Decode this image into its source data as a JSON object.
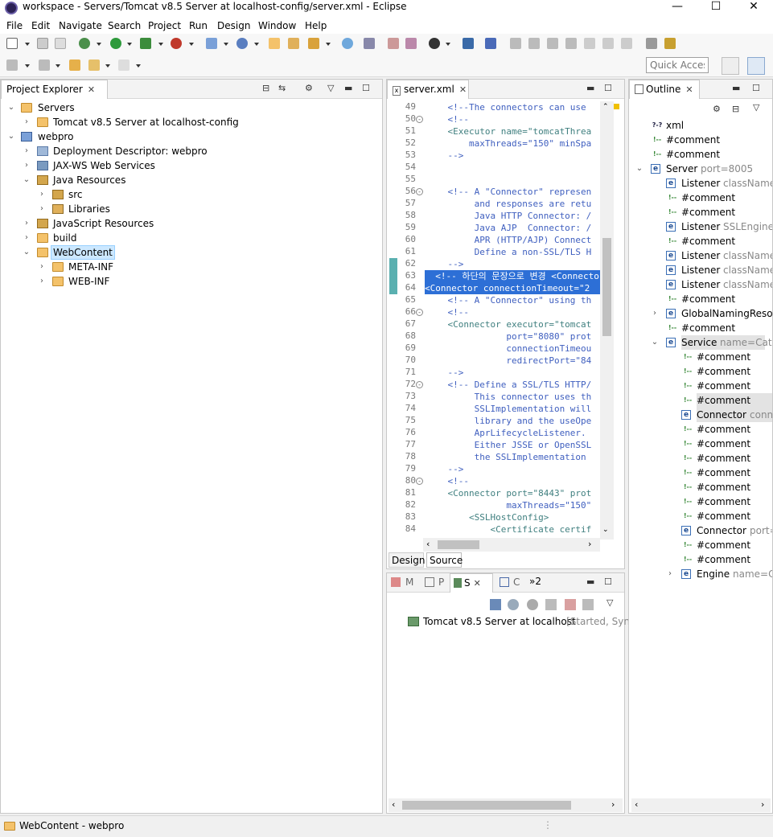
{
  "window": {
    "title": "workspace - Servers/Tomcat v8.5 Server at localhost-config/server.xml - Eclipse",
    "controls": {
      "minimize": "—",
      "maximize": "☐",
      "close": "✕"
    }
  },
  "menu": [
    "File",
    "Edit",
    "Navigate",
    "Search",
    "Project",
    "Run",
    "Design",
    "Window",
    "Help"
  ],
  "quick_access": {
    "placeholder": "Quick Access"
  },
  "project_explorer": {
    "tab_label": "Project Explorer",
    "close": "✕",
    "items": [
      {
        "label": "Servers",
        "icon": "folder-icon",
        "expanded": true
      },
      {
        "label": "Tomcat v8.5 Server at localhost-config",
        "icon": "folder-icon",
        "expanded": false
      },
      {
        "label": "webpro",
        "icon": "project-icon",
        "expanded": true
      },
      {
        "label": "Deployment Descriptor: webpro",
        "icon": "descriptor-icon",
        "expanded": false
      },
      {
        "label": "JAX-WS Web Services",
        "icon": "webservice-icon",
        "expanded": false
      },
      {
        "label": "Java Resources",
        "icon": "java-resources-icon",
        "expanded": true
      },
      {
        "label": "src",
        "icon": "package-folder-icon",
        "expanded": false
      },
      {
        "label": "Libraries",
        "icon": "library-icon",
        "expanded": false
      },
      {
        "label": "JavaScript Resources",
        "icon": "js-resources-icon",
        "expanded": false
      },
      {
        "label": "build",
        "icon": "folder-icon",
        "expanded": false
      },
      {
        "label": "WebContent",
        "icon": "folder-icon",
        "expanded": true,
        "selected": true
      },
      {
        "label": "META-INF",
        "icon": "folder-icon",
        "expanded": false
      },
      {
        "label": "WEB-INF",
        "icon": "folder-icon",
        "expanded": false
      }
    ]
  },
  "editor": {
    "tab_label": "server.xml",
    "close": "✕",
    "bottom_tabs": [
      "Design",
      "Source"
    ],
    "active_bottom_tab": "Source",
    "lines": [
      {
        "n": "49",
        "text": "    <!--The connectors can use"
      },
      {
        "n": "50",
        "text": "    <!--",
        "fold": true
      },
      {
        "n": "51",
        "text": "    <Executor name=\"tomcatThrea"
      },
      {
        "n": "52",
        "text": "        maxThreads=\"150\" minSpa"
      },
      {
        "n": "53",
        "text": "    -->"
      },
      {
        "n": "54",
        "text": ""
      },
      {
        "n": "55",
        "text": ""
      },
      {
        "n": "56",
        "text": "    <!-- A \"Connector\" represen",
        "fold": true
      },
      {
        "n": "57",
        "text": "         and responses are retu"
      },
      {
        "n": "58",
        "text": "         Java HTTP Connector: /"
      },
      {
        "n": "59",
        "text": "         Java AJP  Connector: /"
      },
      {
        "n": "60",
        "text": "         APR (HTTP/AJP) Connect"
      },
      {
        "n": "61",
        "text": "         Define a non-SSL/TLS H"
      },
      {
        "n": "62",
        "text": "    -->"
      },
      {
        "n": "63",
        "text": "  <!-- 하단의 문장으로 변경 <Connector",
        "highlight": true
      },
      {
        "n": "64",
        "text": "<Connector connectionTimeout=\"2",
        "highlight": true
      },
      {
        "n": "65",
        "text": "    <!-- A \"Connector\" using th"
      },
      {
        "n": "66",
        "text": "    <!--",
        "fold": true
      },
      {
        "n": "67",
        "text": "    <Connector executor=\"tomcat"
      },
      {
        "n": "68",
        "text": "               port=\"8080\" prot"
      },
      {
        "n": "69",
        "text": "               connectionTimeou"
      },
      {
        "n": "70",
        "text": "               redirectPort=\"84"
      },
      {
        "n": "71",
        "text": "    -->"
      },
      {
        "n": "72",
        "text": "    <!-- Define a SSL/TLS HTTP/",
        "fold": true
      },
      {
        "n": "73",
        "text": "         This connector uses th"
      },
      {
        "n": "74",
        "text": "         SSLImplementation will"
      },
      {
        "n": "75",
        "text": "         library and the useOpe"
      },
      {
        "n": "76",
        "text": "         AprLifecycleListener."
      },
      {
        "n": "77",
        "text": "         Either JSSE or OpenSSL"
      },
      {
        "n": "78",
        "text": "         the SSLImplementation"
      },
      {
        "n": "79",
        "text": "    -->"
      },
      {
        "n": "80",
        "text": "    <!--",
        "fold": true
      },
      {
        "n": "81",
        "text": "    <Connector port=\"8443\" prot"
      },
      {
        "n": "82",
        "text": "               maxThreads=\"150\""
      },
      {
        "n": "83",
        "text": "        <SSLHostConfig>"
      },
      {
        "n": "84",
        "text": "            <Certificate certif"
      }
    ]
  },
  "outline": {
    "tab_label": "Outline",
    "close": "✕",
    "items": [
      {
        "kind": "pi",
        "label": "xml",
        "extra": ""
      },
      {
        "kind": "comment",
        "label": "#comment",
        "extra": ""
      },
      {
        "kind": "comment",
        "label": "#comment",
        "extra": ""
      },
      {
        "kind": "element",
        "label": "Server",
        "extra": "port=8005",
        "expanded": true
      },
      {
        "kind": "element",
        "label": "Listener",
        "extra": "className="
      },
      {
        "kind": "comment",
        "label": "#comment",
        "extra": ""
      },
      {
        "kind": "comment",
        "label": "#comment",
        "extra": ""
      },
      {
        "kind": "element",
        "label": "Listener",
        "extra": "SSLEngine="
      },
      {
        "kind": "comment",
        "label": "#comment",
        "extra": ""
      },
      {
        "kind": "element",
        "label": "Listener",
        "extra": "className="
      },
      {
        "kind": "element",
        "label": "Listener",
        "extra": "className="
      },
      {
        "kind": "element",
        "label": "Listener",
        "extra": "className="
      },
      {
        "kind": "comment",
        "label": "#comment",
        "extra": ""
      },
      {
        "kind": "element",
        "label": "GlobalNamingResou",
        "extra": "",
        "collapsed": true
      },
      {
        "kind": "comment",
        "label": "#comment",
        "extra": ""
      },
      {
        "kind": "element",
        "label": "Service",
        "extra": "name=Catali",
        "expanded": true,
        "hl": true
      },
      {
        "kind": "comment",
        "label": "#comment",
        "extra": ""
      },
      {
        "kind": "comment",
        "label": "#comment",
        "extra": ""
      },
      {
        "kind": "comment",
        "label": "#comment",
        "extra": ""
      },
      {
        "kind": "comment",
        "label": "#comment",
        "extra": "",
        "hl": true
      },
      {
        "kind": "element",
        "label": "Connector",
        "extra": "conne",
        "hl": true
      },
      {
        "kind": "comment",
        "label": "#comment",
        "extra": ""
      },
      {
        "kind": "comment",
        "label": "#comment",
        "extra": ""
      },
      {
        "kind": "comment",
        "label": "#comment",
        "extra": ""
      },
      {
        "kind": "comment",
        "label": "#comment",
        "extra": ""
      },
      {
        "kind": "comment",
        "label": "#comment",
        "extra": ""
      },
      {
        "kind": "comment",
        "label": "#comment",
        "extra": ""
      },
      {
        "kind": "comment",
        "label": "#comment",
        "extra": ""
      },
      {
        "kind": "element",
        "label": "Connector",
        "extra": "port="
      },
      {
        "kind": "comment",
        "label": "#comment",
        "extra": ""
      },
      {
        "kind": "comment",
        "label": "#comment",
        "extra": ""
      },
      {
        "kind": "element",
        "label": "Engine",
        "extra": "name=Ca",
        "collapsed": true
      }
    ]
  },
  "servers_view": {
    "tabs": [
      "M",
      "P",
      "S",
      "C",
      "»2"
    ],
    "active_tab": "S",
    "server_name": "Tomcat v8.5 Server at localhost",
    "server_status": "[Started, Syn"
  },
  "status_bar": {
    "text": "WebContent - webpro"
  }
}
